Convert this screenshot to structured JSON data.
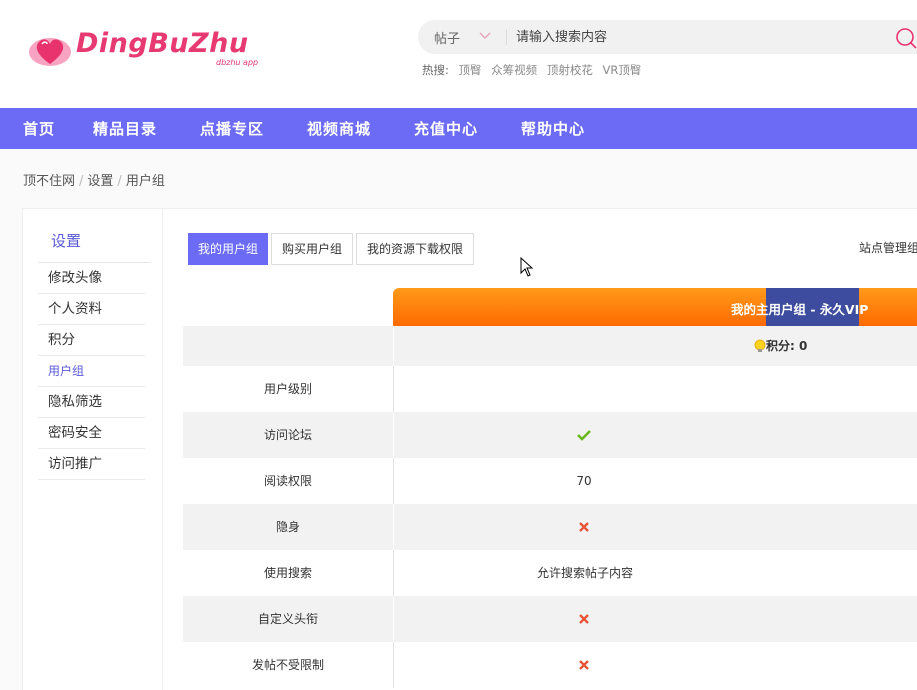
{
  "logo": {
    "text": "DingBuZhu",
    "sub": "dbzhu app",
    "color": "#e83a72"
  },
  "search": {
    "type_label": "帖子",
    "placeholder": "请输入搜索内容",
    "hot_label": "热搜:",
    "hot_items": [
      "顶臀",
      "众筹视频",
      "顶射校花",
      "VR顶臀"
    ]
  },
  "nav": {
    "color": "#6b6bf5",
    "items": [
      "首页",
      "精品目录",
      "点播专区",
      "视频商城",
      "充值中心",
      "帮助中心"
    ]
  },
  "breadcrumb": [
    "顶不住网",
    "设置",
    "用户组"
  ],
  "sidebar": {
    "title": "设置",
    "items": [
      {
        "label": "修改头像",
        "active": false
      },
      {
        "label": "个人资料",
        "active": false
      },
      {
        "label": "积分",
        "active": false
      },
      {
        "label": "用户组",
        "active": true
      },
      {
        "label": "隐私筛选",
        "active": false
      },
      {
        "label": "密码安全",
        "active": false
      },
      {
        "label": "访问推广",
        "active": false
      }
    ]
  },
  "tabs": [
    {
      "label": "我的用户组",
      "active": true
    },
    {
      "label": "购买用户组",
      "active": false
    },
    {
      "label": "我的资源下载权限",
      "active": false
    }
  ],
  "site_admin_label": "站点管理组",
  "group_table": {
    "header": "我的主用户组 - 永久VIP",
    "score_label": "积分: 0",
    "rows": [
      {
        "label": "用户级别",
        "value": "",
        "kind": "text"
      },
      {
        "label": "访问论坛",
        "value": "check",
        "kind": "icon"
      },
      {
        "label": "阅读权限",
        "value": "70",
        "kind": "text"
      },
      {
        "label": "隐身",
        "value": "cross",
        "kind": "icon"
      },
      {
        "label": "使用搜索",
        "value": "允许搜索帖子内容",
        "kind": "text"
      },
      {
        "label": "自定义头衔",
        "value": "cross",
        "kind": "icon"
      },
      {
        "label": "发帖不受限制",
        "value": "cross",
        "kind": "icon"
      }
    ]
  }
}
